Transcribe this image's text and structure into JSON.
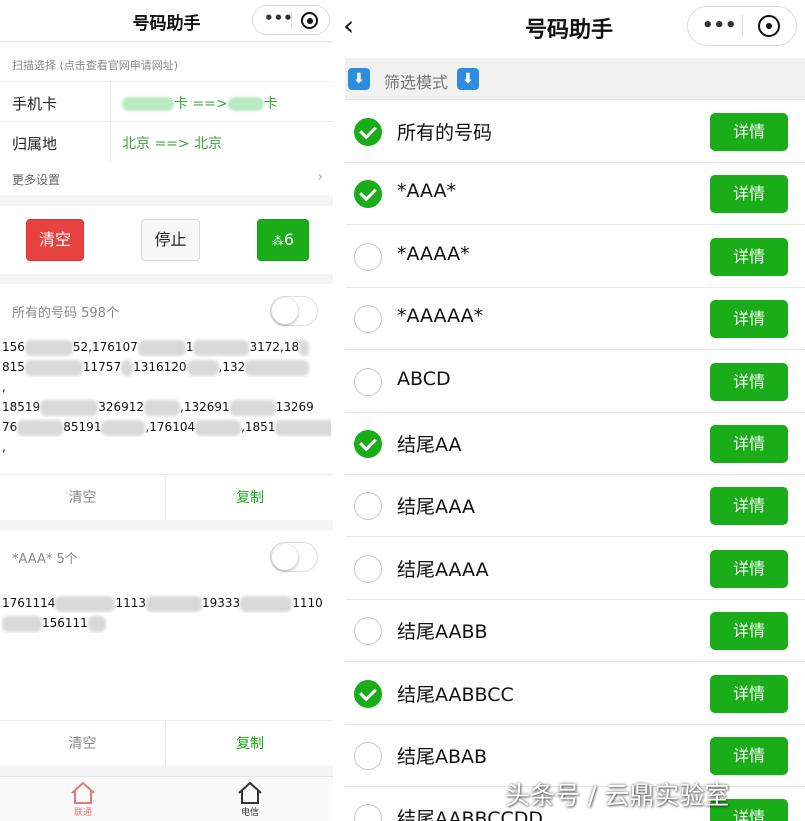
{
  "left": {
    "title": "号码助手",
    "scan_hint": "扫描选择 (点击查看官网申请网址)",
    "rows": [
      {
        "label": "手机卡",
        "value_mid": "卡 ==>",
        "value_end": "卡"
      },
      {
        "label": "归属地",
        "value": "北京 ==> 北京"
      }
    ],
    "more_settings": "更多设置",
    "buttons": {
      "clear": "清空",
      "stop": "停止",
      "progress": "6"
    },
    "sections": [
      {
        "title": "所有的号码 598个",
        "lines": [
          [
            "156",
            "52,176107",
            "1",
            "3172,18"
          ],
          [
            "815",
            "11757",
            "1316120",
            ",132",
            ""
          ],
          [
            ","
          ],
          [
            "18519",
            "326912",
            ",132691",
            "13269"
          ],
          [
            "76",
            "85191",
            ",176104",
            ",1851",
            ""
          ],
          [
            ","
          ]
        ],
        "clear": "清空",
        "copy": "复制"
      },
      {
        "title": "*AAA* 5个",
        "lines": [
          [
            "1761114",
            "1113",
            "19333",
            "1110"
          ],
          [
            "",
            "156111",
            ""
          ]
        ],
        "clear": "清空",
        "copy": "复制"
      }
    ],
    "tabs": [
      {
        "label": "联通",
        "color": "#e07a7a"
      },
      {
        "label": "电信",
        "color": "#333333"
      }
    ]
  },
  "right": {
    "title": "号码助手",
    "filter_title": "筛选模式",
    "detail_label": "详情",
    "options": [
      {
        "label": "所有的号码",
        "checked": true
      },
      {
        "label": "*AAA*",
        "checked": true
      },
      {
        "label": "*AAAA*",
        "checked": false
      },
      {
        "label": "*AAAAA*",
        "checked": false
      },
      {
        "label": "ABCD",
        "checked": false
      },
      {
        "label": "结尾AA",
        "checked": true
      },
      {
        "label": "结尾AAA",
        "checked": false
      },
      {
        "label": "结尾AAAA",
        "checked": false
      },
      {
        "label": "结尾AABB",
        "checked": false
      },
      {
        "label": "结尾AABBCC",
        "checked": true
      },
      {
        "label": "结尾ABAB",
        "checked": false
      },
      {
        "label": "结尾AABBCCDD",
        "checked": false
      }
    ]
  },
  "watermark": "头条号 / 云鼎实验室",
  "colors": {
    "accent_green": "#1aad19",
    "danger_red": "#e64340",
    "link_green": "#3aa83a",
    "filter_blue": "#2b8ce0"
  }
}
